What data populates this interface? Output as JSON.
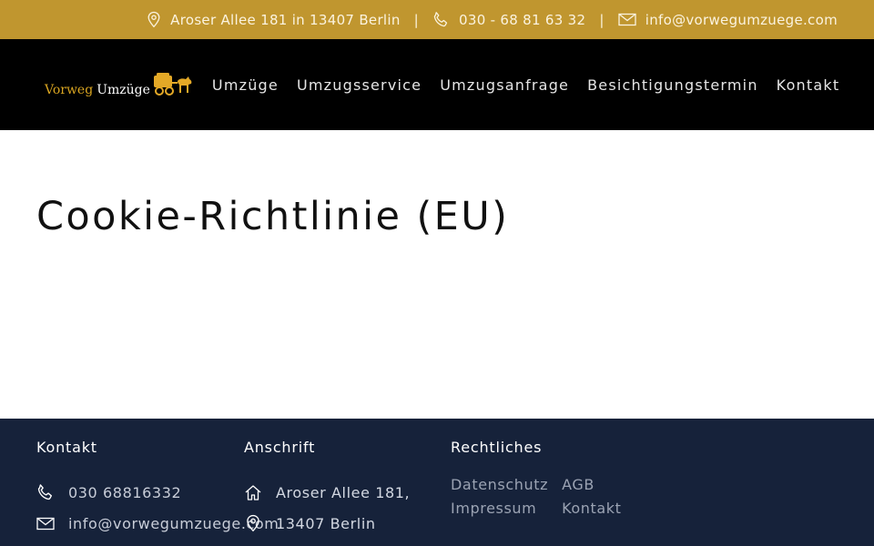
{
  "topbar": {
    "address": "Aroser Allee 181 in 13407 Berlin",
    "separator": "|",
    "phone": "030 - 68 81 63 32",
    "email": "info@vorwegumzuege.com"
  },
  "header": {
    "logo_word1": "Vorweg",
    "logo_word2": "Umzüge",
    "nav": [
      {
        "label": "Umzüge"
      },
      {
        "label": "Umzugsservice"
      },
      {
        "label": "Umzugsanfrage"
      },
      {
        "label": "Besichtigungstermin"
      },
      {
        "label": "Kontakt"
      }
    ]
  },
  "main": {
    "title": "Cookie-Richtlinie (EU)"
  },
  "footer": {
    "contact": {
      "heading": "Kontakt",
      "phone": "030 68816332",
      "email": "info@vorwegumzuege.com"
    },
    "address": {
      "heading": "Anschrift",
      "line1": "Aroser Allee 181,",
      "line2": "13407 Berlin"
    },
    "legal": {
      "heading": "Rechtliches",
      "links": [
        "Datenschutz",
        "AGB",
        "Impressum",
        "Kontakt"
      ]
    }
  },
  "colors": {
    "topbar_bg": "#c0962f",
    "nav_bg": "#000000",
    "footer_bg": "#16223a",
    "logo_gold": "#d9a521"
  },
  "icons": {
    "topbar": [
      "map-pin-icon",
      "phone-icon",
      "mail-icon"
    ],
    "logo": "horse-carriage-icon",
    "footer": [
      "phone-icon",
      "mail-icon",
      "home-icon",
      "map-pin-icon"
    ]
  }
}
